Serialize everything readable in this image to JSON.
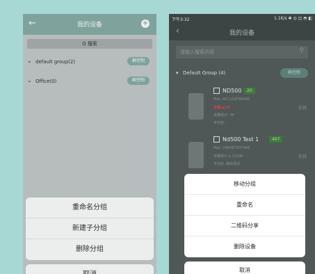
{
  "left_screen": {
    "header_title": "我的设备",
    "search_label": "Q 搜索",
    "groups": [
      {
        "name": "default group(2)",
        "button": "群控制"
      },
      {
        "name": "Office(0)",
        "button": "群控制"
      }
    ],
    "action_sheet": [
      "重命名分组",
      "新建子分组",
      "删除分组"
    ],
    "cancel_label": "取消"
  },
  "right_screen": {
    "status_time": "下午3:32",
    "status_right": "1.1K/s ✱ ◎ ◫ ◓ ◧",
    "header_title": "我的设备",
    "search_placeholder": "请输入搜索内容",
    "group_name": "Default Group (4)",
    "group_button": "群控制",
    "devices": [
      {
        "name": "ND500",
        "tag": "20",
        "mac": "Mac: AC1102F8954D",
        "line2": "告警(g):6",
        "line3": "流量统计: -M",
        "line4": "手动自: -",
        "status": "在线"
      },
      {
        "name": "Nd500 Test 1",
        "tag": "407",
        "mac": "Mac: 1AEAE7A37A0E",
        "line2": "流量统计:1.7/22M",
        "line3": "手动自: 路由测试",
        "line4": "",
        "status": "在线"
      }
    ],
    "action_sheet": [
      "移动分组",
      "重命名",
      "二维码分享",
      "删除设备"
    ],
    "cancel_label": "取消"
  }
}
